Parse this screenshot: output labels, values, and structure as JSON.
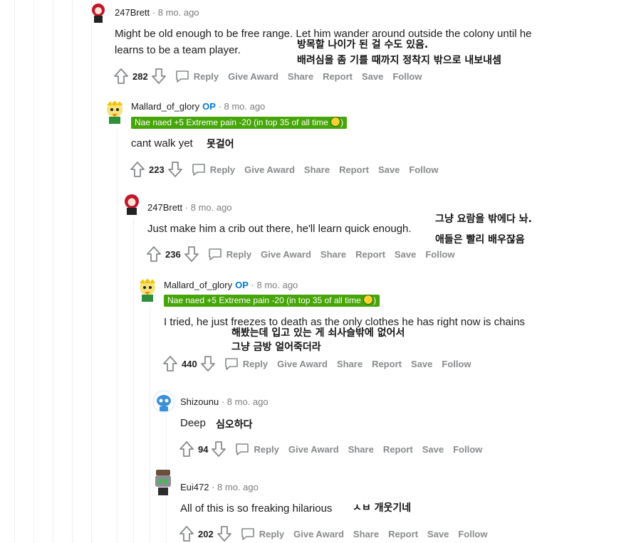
{
  "comments": [
    {
      "user": "247Brett",
      "age": "· 8 mo. ago",
      "text": "Might be old enough to be free range. Let him wander around outside the colony until he learns to be a team player.",
      "translation": [
        "방목할 나이가 된 걸 수도 있음.",
        "배려심을 좀 기를 때까지 정착지 밖으로 내보내셈"
      ],
      "score": "282"
    },
    {
      "user": "Mallard_of_glory",
      "op": "OP",
      "age": "· 8 mo. ago",
      "flair": "Nae naed +5 Extreme pain -20 (in top 35 of all time",
      "text": "cant walk yet",
      "translation": [
        "못걸어"
      ],
      "score": "223"
    },
    {
      "user": "247Brett",
      "age": "· 8 mo. ago",
      "text": "Just make him a crib out there, he'll learn quick enough.",
      "translation": [
        "그냥 요람을 밖에다 놔.",
        "애들은 빨리 배우잖음"
      ],
      "score": "236"
    },
    {
      "user": "Mallard_of_glory",
      "op": "OP",
      "age": "· 8 mo. ago",
      "flair": "Nae naed +5 Extreme pain -20 (in top 35 of all time",
      "text": "I tried, he just freezes to death as the only clothes he has right now is chains",
      "translation": [
        "해봤는데 입고 있는 게 쇠사슬밖에 없어서",
        "그냥 금방 얼어죽더라"
      ],
      "score": "440"
    },
    {
      "user": "Shizounu",
      "age": "· 8 mo. ago",
      "text": "Deep",
      "translation": [
        "심오하다"
      ],
      "score": "94"
    },
    {
      "user": "Eui472",
      "age": "· 8 mo. ago",
      "text": "All of this is so freaking hilarious",
      "translation": [
        "ㅅㅂ 개웃기네"
      ],
      "score": "202"
    }
  ],
  "actions": {
    "reply": "Reply",
    "give_award": "Give Award",
    "share": "Share",
    "report": "Report",
    "save": "Save",
    "follow": "Follow"
  },
  "icons": {
    "upvote": "upvote-arrow-icon",
    "downvote": "downvote-arrow-icon",
    "reply": "reply-bubble-icon"
  },
  "colors": {
    "op": "#0079d3",
    "flair_bg": "#46a508",
    "muted": "#878a8c"
  }
}
